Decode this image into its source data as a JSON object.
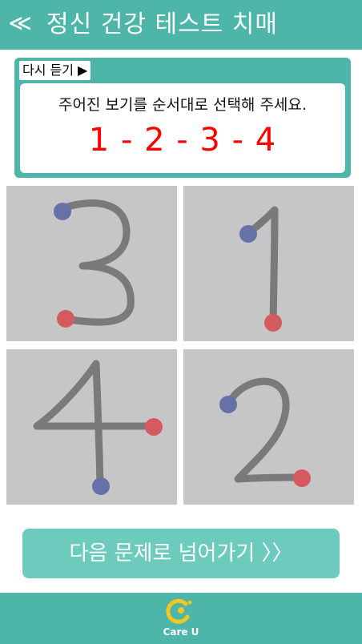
{
  "header": {
    "back_icon": "double-chevron-left-icon",
    "back_label": "≪",
    "title": "정신 건강 테스트 치매"
  },
  "question": {
    "replay_label": "다시 듣기 ▶",
    "instruction": "주어진 보기를 순서대로 선택해 주세요.",
    "sequence": "1 - 2 - 3 - 4"
  },
  "cards": [
    {
      "digit": "3"
    },
    {
      "digit": "1"
    },
    {
      "digit": "4"
    },
    {
      "digit": "2"
    }
  ],
  "next_button": {
    "label": "다음 문제로 넘어가기 〉〉"
  },
  "footer": {
    "logo_text": "Care U"
  },
  "colors": {
    "teal": "#4db6a8",
    "button_teal": "#6ccbbd",
    "red_text": "#ff0000",
    "card_gray": "#c6c6c6",
    "stroke_gray": "#7a7a7a",
    "start_dot_blue": "#6671a8",
    "end_dot_red": "#d45a5f",
    "logo_yellow": "#f3c623"
  }
}
